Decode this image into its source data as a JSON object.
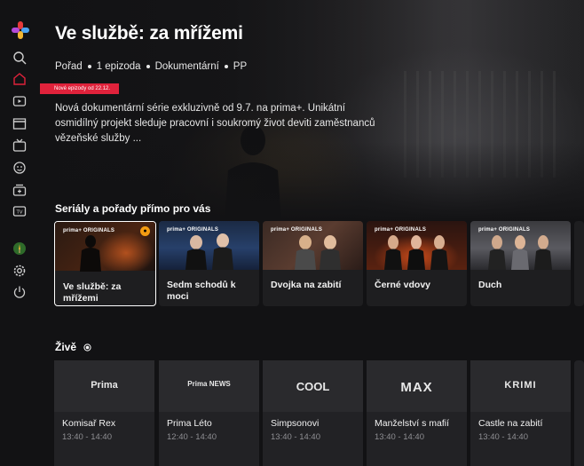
{
  "hero": {
    "title": "Ve službě: za mřížemi",
    "meta": [
      "Pořad",
      "1 epizoda",
      "Dokumentární",
      "PP"
    ],
    "badge": "Nové epizody od 22.12.",
    "description": "Nová dokumentární série exkluzivně od 9.7. na prima+. Unikátní osmidílný projekt sleduje pracovní i soukromý život deviti zaměstnanců vězeňské služby ..."
  },
  "sidebar": {
    "icons": [
      "prima-plus-logo-icon",
      "search-icon",
      "home-icon",
      "play-icon",
      "clapperboard-icon",
      "tv-icon",
      "kids-icon",
      "tv-add-icon",
      "tv-guide-icon",
      "profile-avatar-icon",
      "settings-icon",
      "power-icon"
    ]
  },
  "sections": {
    "recommended_title": "Seriály a pořady přímo pro vás",
    "live_title": "Živě"
  },
  "cards": [
    {
      "brand": "prima+ ORIGINALS",
      "title": "Ve službě: za mřížemi",
      "locked": true
    },
    {
      "brand": "prima+ ORIGINALS",
      "title": "Sedm schodů k moci",
      "locked": false
    },
    {
      "brand": "prima+ ORIGINALS",
      "title": "Dvojka na zabití",
      "locked": false
    },
    {
      "brand": "prima+ ORIGINALS",
      "title": "Černé vdovy",
      "locked": false
    },
    {
      "brand": "prima+ ORIGINALS",
      "title": "Duch",
      "locked": false
    }
  ],
  "live": [
    {
      "channel": "Prima",
      "show": "Komisař Rex",
      "time": "13:40 - 14:40"
    },
    {
      "channel": "Prima NEWS",
      "show": "Prima Léto",
      "time": "12:40 - 14:40"
    },
    {
      "channel": "COOL",
      "show": "Simpsonovi",
      "time": "13:40 - 14:40"
    },
    {
      "channel": "MAX",
      "show": "Manželství s mafií",
      "time": "13:40 - 14:40"
    },
    {
      "channel": "KRIMI",
      "show": "Castle na zabití",
      "time": "13:40 - 14:40"
    }
  ],
  "colors": {
    "accent": "#e0223b",
    "background": "#121214",
    "lock": "#f39c12"
  }
}
